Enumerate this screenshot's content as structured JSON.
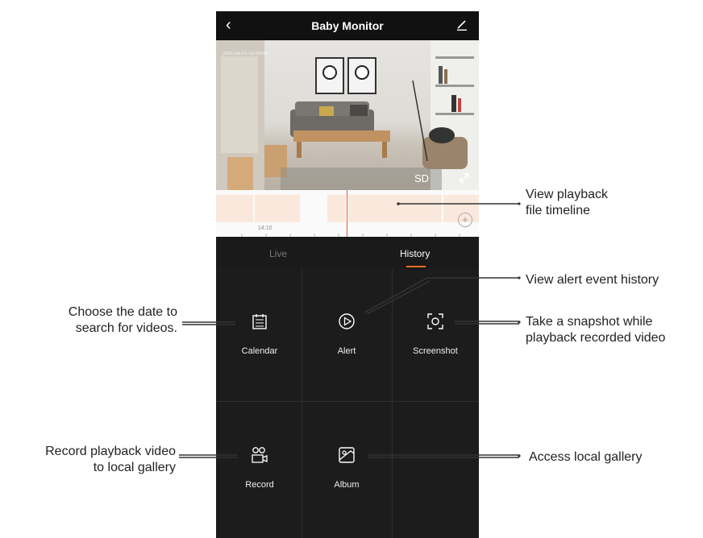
{
  "app": {
    "title": "Baby Monitor",
    "back_icon": "back-chevron-icon",
    "edit_icon": "edit-pencil-icon"
  },
  "video": {
    "timestamp": "2021-05-01  15:00:00",
    "quality": "SD",
    "fullscreen_icon": "expand-icon"
  },
  "timeline": {
    "time_label": "14:10",
    "zoom_icon": "plus-circle-icon",
    "playhead_color": "#e35a3a",
    "segment_color": "#fbe8dc"
  },
  "tabs": [
    {
      "label": "Live",
      "active": false
    },
    {
      "label": "History",
      "active": true
    }
  ],
  "accent_color": "#f26b21",
  "actions": [
    {
      "label": "Calendar",
      "icon": "calendar-icon"
    },
    {
      "label": "Alert",
      "icon": "play-circle-icon"
    },
    {
      "label": "Screenshot",
      "icon": "camera-frame-icon"
    },
    {
      "label": "Record",
      "icon": "record-video-icon"
    },
    {
      "label": "Album",
      "icon": "album-image-icon"
    }
  ],
  "annotations": {
    "timeline": [
      "View playback",
      "file timeline"
    ],
    "alert": "View alert event history",
    "calendar": [
      "Choose the date to",
      "search for videos."
    ],
    "screenshot": [
      "Take a snapshot while",
      "playback recorded video"
    ],
    "record": [
      "Record playback video",
      "to local gallery"
    ],
    "album": "Access local gallery"
  }
}
